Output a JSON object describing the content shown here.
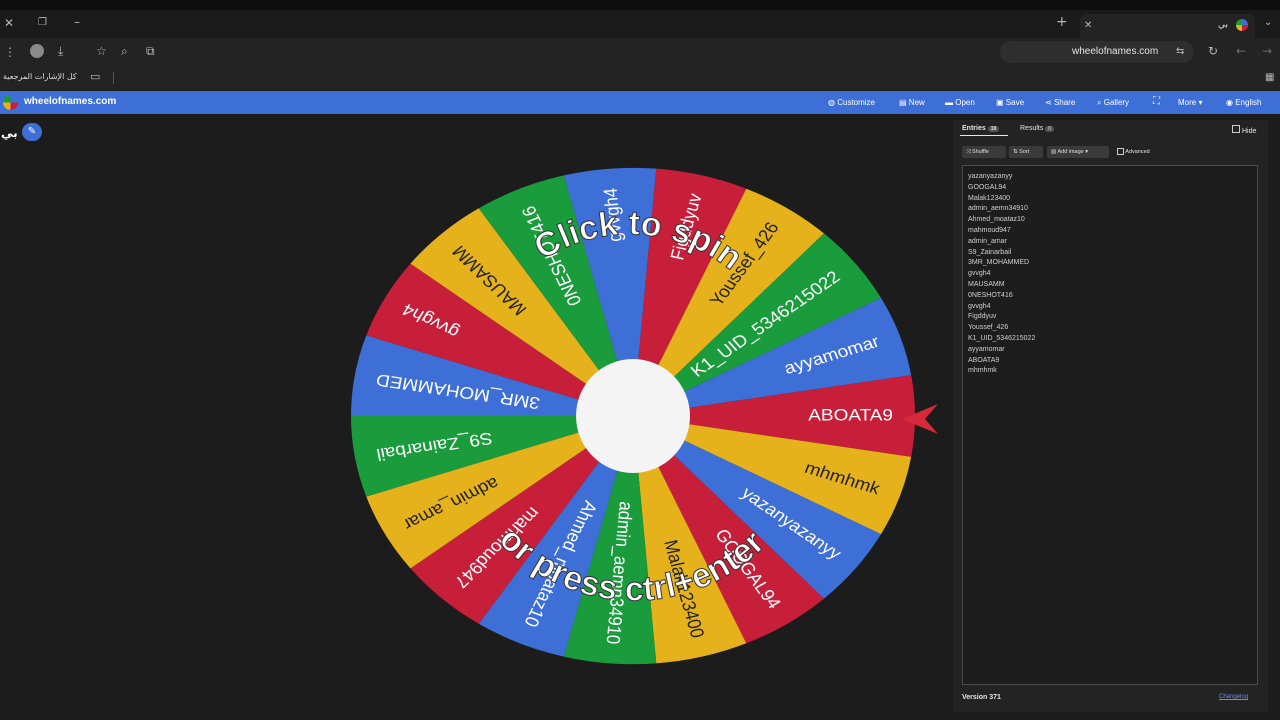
{
  "browser": {
    "tab_title": "بي",
    "address": "wheelofnames.com",
    "bookmarks_label": "كل الإشارات المرجعية"
  },
  "app": {
    "logo_text": "wheelofnames.com",
    "wheel_title": "بي",
    "menu": [
      {
        "label": "Customize",
        "icon": "palette-icon"
      },
      {
        "label": "New",
        "icon": "new-file-icon"
      },
      {
        "label": "Open",
        "icon": "folder-icon"
      },
      {
        "label": "Save",
        "icon": "save-icon"
      },
      {
        "label": "Share",
        "icon": "share-icon"
      },
      {
        "label": "Gallery",
        "icon": "search-icon"
      },
      {
        "label": "",
        "icon": "fullscreen-icon"
      },
      {
        "label": "More",
        "icon": "chevron-down-icon"
      },
      {
        "label": "English",
        "icon": "globe-icon"
      }
    ]
  },
  "wheel": {
    "top_text": "Click to spin",
    "bottom_text": "or press ctrl+enter",
    "segments": [
      {
        "label": "yazanyazanyy",
        "color": "#3d6fd6"
      },
      {
        "label": "GOOGAL94",
        "color": "#c71f3a"
      },
      {
        "label": "Malak123400",
        "color": "#e6b21c"
      },
      {
        "label": "admin_aemn34910",
        "color": "#1a9b3c"
      },
      {
        "label": "Ahmed_moataz10",
        "color": "#3d6fd6"
      },
      {
        "label": "mahmoud947",
        "color": "#c71f3a"
      },
      {
        "label": "admin_amar",
        "color": "#e6b21c"
      },
      {
        "label": "S9_Zainarbail",
        "color": "#1a9b3c"
      },
      {
        "label": "3MR_MOHAMMED",
        "color": "#3d6fd6"
      },
      {
        "label": "gvvgh4",
        "color": "#c71f3a"
      },
      {
        "label": "MAUSAMM",
        "color": "#e6b21c"
      },
      {
        "label": "0NESHOT416",
        "color": "#1a9b3c"
      },
      {
        "label": "gvvgh4",
        "color": "#3d6fd6"
      },
      {
        "label": "Figddyuv",
        "color": "#c71f3a"
      },
      {
        "label": "Youssef_426",
        "color": "#e6b21c"
      },
      {
        "label": "K1_UID_5346215022",
        "color": "#1a9b3c"
      },
      {
        "label": "ayyamomar",
        "color": "#3d6fd6"
      },
      {
        "label": "ABOATA9",
        "color": "#c71f3a"
      },
      {
        "label": "mhmhmk",
        "color": "#e6b21c"
      }
    ],
    "pointer_color": "#d62a3a"
  },
  "panel": {
    "tabs": {
      "entries": "Entries",
      "entries_count": "19",
      "results": "Results",
      "results_count": "0"
    },
    "hide_label": "Hide",
    "buttons": {
      "shuffle": "Shuffle",
      "sort": "Sort",
      "add_image": "Add image",
      "advanced": "Advanced"
    },
    "entries": [
      "yazanyazanyy",
      "GOOGAL94",
      "Malak123400",
      "admin_aemn34910",
      "Ahmed_moataz10",
      "mahmoud947",
      "admin_amar",
      "S9_Zainarbail",
      "3MR_MOHAMMED",
      "gvvgh4",
      "MAUSAMM",
      "0NESHOT416",
      "gvvgh4",
      "Figddyuv",
      "Youssef_426",
      "K1_UID_5346215022",
      "ayyamomar",
      "ABOATA9",
      "mhmhmk"
    ],
    "version": "Version 371",
    "changelog": "Changelog"
  }
}
